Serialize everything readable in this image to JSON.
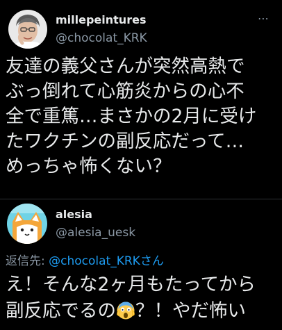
{
  "tweet": {
    "author_name": "millepeintures",
    "author_handle": "@chocolat_KRK",
    "text_lines": [
      "友達の義父さんが突然高熱で",
      "ぶっ倒れて心筋炎からの心不",
      "全で重篤…まさかの2月に受け",
      "たワクチンの副反応だって…",
      "めっちゃ怖くない？"
    ]
  },
  "reply": {
    "author_name": "alesia",
    "author_handle": "@alesia_uesk",
    "replying_to_label": "返信先: ",
    "replying_to_handle": "@chocolat_KRK",
    "replying_to_suffix": "さん",
    "text_line1": "え！そんな2ヶ月もたってから",
    "text_line2_before": "副反応でるの",
    "text_line2_emoji": "face-screaming-in-fear-emoji",
    "text_line2_after": "？！やだ怖い"
  },
  "colors": {
    "background": "#000000",
    "text": "#e7e9ea",
    "secondary": "#8b98a5",
    "link": "#1d9bf0"
  },
  "icons": [
    "more-icon"
  ]
}
